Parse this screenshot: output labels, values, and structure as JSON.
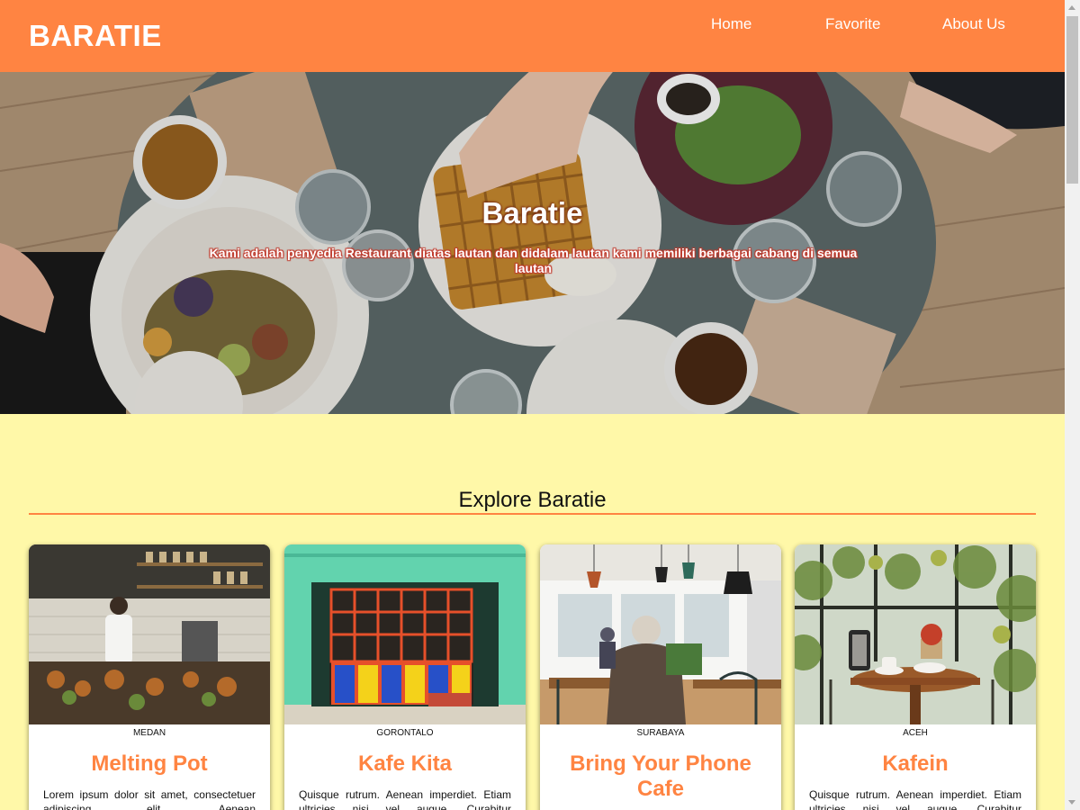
{
  "header": {
    "brand": "BARATIE",
    "nav": [
      {
        "label": "Home"
      },
      {
        "label": "Favorite"
      },
      {
        "label": "About Us"
      }
    ]
  },
  "hero": {
    "title": "Baratie",
    "subtitle": "Kami adalah penyedia Restaurant diatas lautan dan didalam lautan kami memiliki berbagai cabang di semua lautan"
  },
  "explore": {
    "title": "Explore Baratie"
  },
  "cards": [
    {
      "city": "MEDAN",
      "title": "Melting Pot",
      "desc": "Lorem ipsum dolor sit amet, consectetuer adipiscing elit. Aenean"
    },
    {
      "city": "GORONTALO",
      "title": "Kafe Kita",
      "desc": "Quisque rutrum. Aenean imperdiet. Etiam ultricies nisi vel augue. Curabitur"
    },
    {
      "city": "SURABAYA",
      "title": "Bring Your Phone Cafe",
      "desc": ""
    },
    {
      "city": "ACEH",
      "title": "Kafein",
      "desc": "Quisque rutrum. Aenean imperdiet. Etiam ultricies nisi vel augue. Curabitur"
    }
  ],
  "colors": {
    "accent": "#ff8442",
    "background": "#fff8a8"
  }
}
